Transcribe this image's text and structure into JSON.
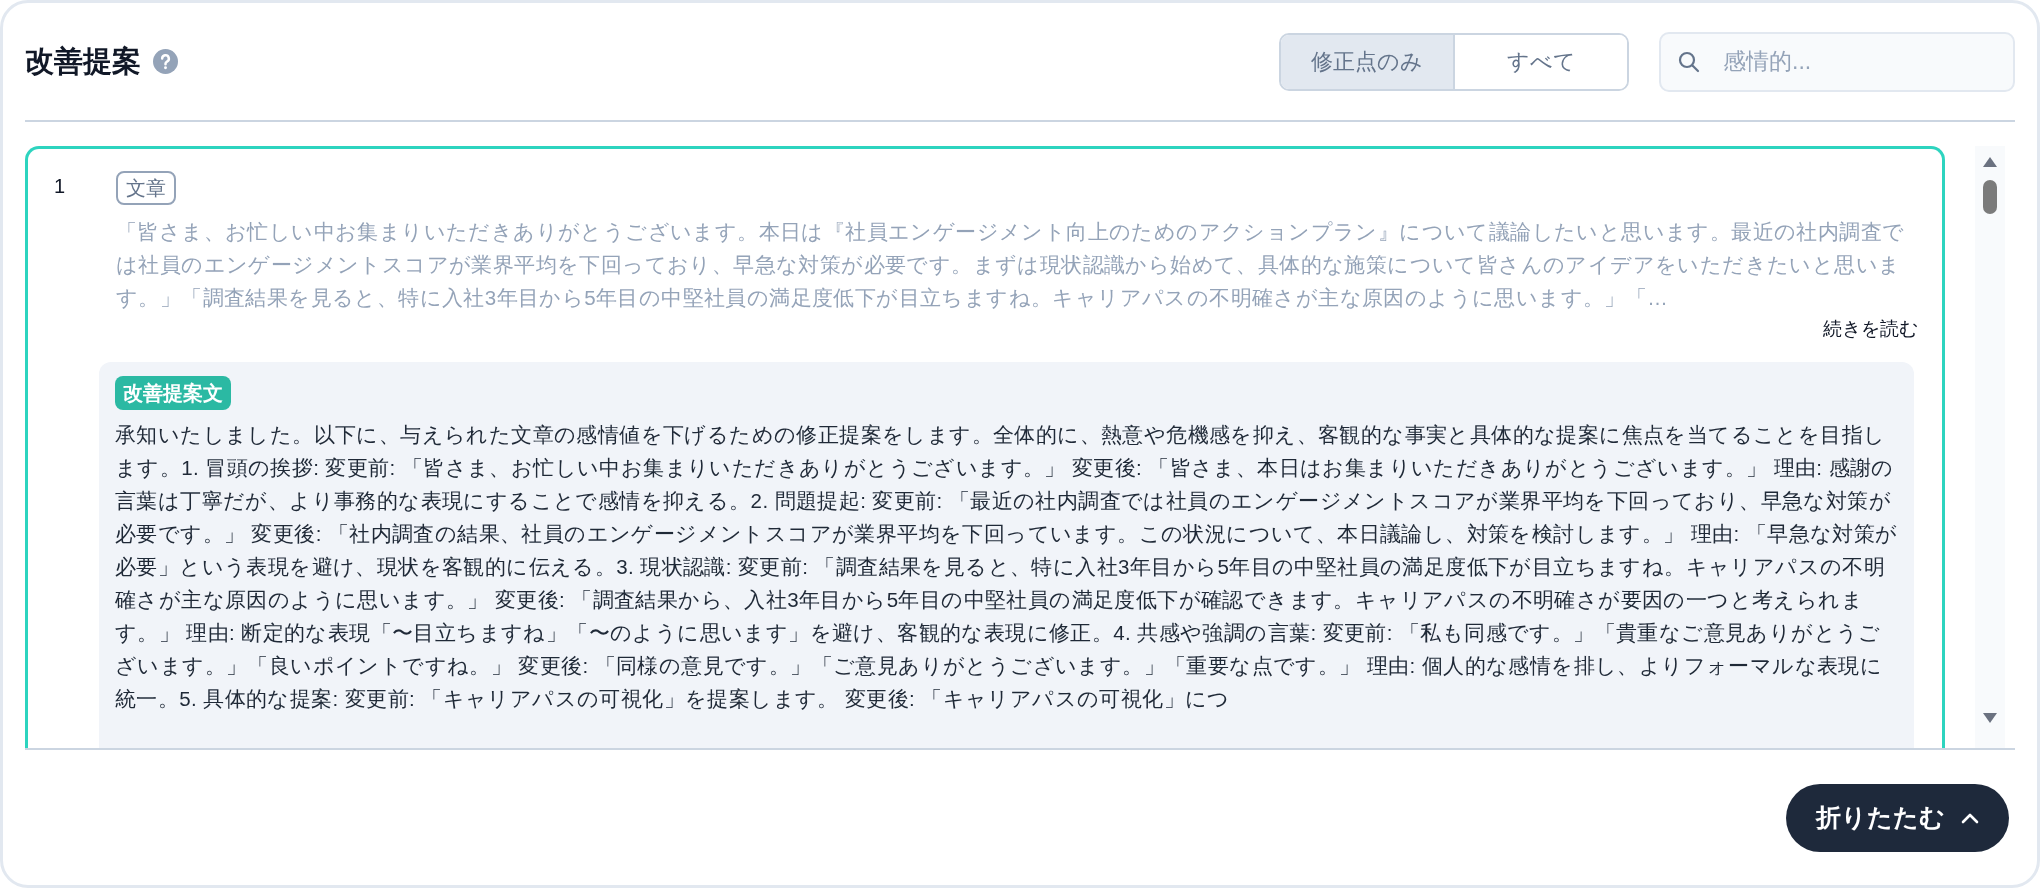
{
  "header": {
    "title": "改善提案",
    "filter": [
      {
        "label": "修正点のみ",
        "selected": true
      },
      {
        "label": "すべて",
        "selected": false
      }
    ],
    "search": {
      "placeholder": "感情的..."
    }
  },
  "items": [
    {
      "number": "1",
      "tag": "文章",
      "original": "「皆さま、お忙しい中お集まりいただきありがとうございます。本日は『社員エンゲージメント向上のためのアクションプラン』について議論したいと思います。最近の社内調査では社員のエンゲージメントスコアが業界平均を下回っており、早急な対策が必要です。まずは現状認識から始めて、具体的な施策について皆さんのアイデアをいただきたいと思います。」「調査結果を見ると、特に入社3年目から5年目の中堅社員の満足度低下が目立ちますね。キャリアパスの不明確さが主な原因のように思います。」「…",
      "read_more": "続きを読む",
      "suggestion_label": "改善提案文",
      "suggestion": "承知いたしました。以下に、与えられた文章の感情値を下げるための修正提案をします。全体的に、熱意や危機感を抑え、客観的な事実と具体的な提案に焦点を当てることを目指します。1. 冒頭の挨拶: 変更前: 「皆さま、お忙しい中お集まりいただきありがとうございます。」 変更後: 「皆さま、本日はお集まりいただきありがとうございます。」 理由: 感謝の言葉は丁寧だが、より事務的な表現にすることで感情を抑える。2. 問題提起: 変更前: 「最近の社内調査では社員のエンゲージメントスコアが業界平均を下回っており、早急な対策が必要です。」 変更後: 「社内調査の結果、社員のエンゲージメントスコアが業界平均を下回っています。この状況について、本日議論し、対策を検討します。」 理由: 「早急な対策が必要」という表現を避け、現状を客観的に伝える。3. 現状認識: 変更前: 「調査結果を見ると、特に入社3年目から5年目の中堅社員の満足度低下が目立ちますね。キャリアパスの不明確さが主な原因のように思います。」 変更後: 「調査結果から、入社3年目から5年目の中堅社員の満足度低下が確認できます。キャリアパスの不明確さが要因の一つと考えられます。」 理由: 断定的な表現「〜目立ちますね」「〜のように思います」を避け、客観的な表現に修正。4. 共感や強調の言葉: 変更前: 「私も同感です。」「貴重なご意見ありがとうございます。」「良いポイントですね。」 変更後: 「同様の意見です。」「ご意見ありがとうございます。」「重要な点です。」 理由: 個人的な感情を排し、よりフォーマルな表現に統一。5. 具体的な提案: 変更前: 「キャリアパスの可視化」を提案します。 変更後: 「キャリアパスの可視化」につ"
    }
  ],
  "footer": {
    "collapse": "折りたたむ"
  }
}
